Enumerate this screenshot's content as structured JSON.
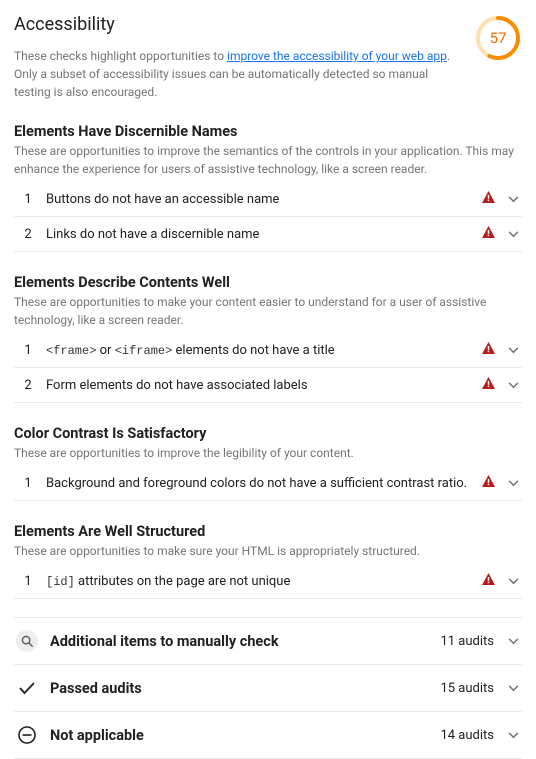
{
  "header": {
    "title": "Accessibility",
    "subtitle_pre": "These checks highlight opportunities to ",
    "subtitle_link": "improve the accessibility of your web app",
    "subtitle_post": ". Only a subset of accessibility issues can be automatically detected so manual testing is also encouraged."
  },
  "score": "57",
  "groups": [
    {
      "title": "Elements Have Discernible Names",
      "desc": "These are opportunities to improve the semantics of the controls in your application. This may enhance the experience for users of assistive technology, like a screen reader.",
      "audits": [
        {
          "idx": "1",
          "text": "Buttons do not have an accessible name"
        },
        {
          "idx": "2",
          "text": "Links do not have a discernible name"
        }
      ]
    },
    {
      "title": "Elements Describe Contents Well",
      "desc": "These are opportunities to make your content easier to understand for a user of assistive technology, like a screen reader.",
      "audits": [
        {
          "idx": "1",
          "html": "<code>&lt;frame&gt;</code> or <code>&lt;iframe&gt;</code> elements do not have a title"
        },
        {
          "idx": "2",
          "text": "Form elements do not have associated labels"
        }
      ]
    },
    {
      "title": "Color Contrast Is Satisfactory",
      "desc": "These are opportunities to improve the legibility of your content.",
      "audits": [
        {
          "idx": "1",
          "text": "Background and foreground colors do not have a sufficient contrast ratio."
        }
      ]
    },
    {
      "title": "Elements Are Well Structured",
      "desc": "These are opportunities to make sure your HTML is appropriately structured.",
      "audits": [
        {
          "idx": "1",
          "html": "<code>[id]</code> attributes on the page are not unique"
        }
      ]
    }
  ],
  "summary": [
    {
      "icon": "search",
      "label": "Additional items to manually check",
      "count": "11 audits"
    },
    {
      "icon": "check",
      "label": "Passed audits",
      "count": "15 audits"
    },
    {
      "icon": "not-applicable",
      "label": "Not applicable",
      "count": "14 audits"
    }
  ]
}
